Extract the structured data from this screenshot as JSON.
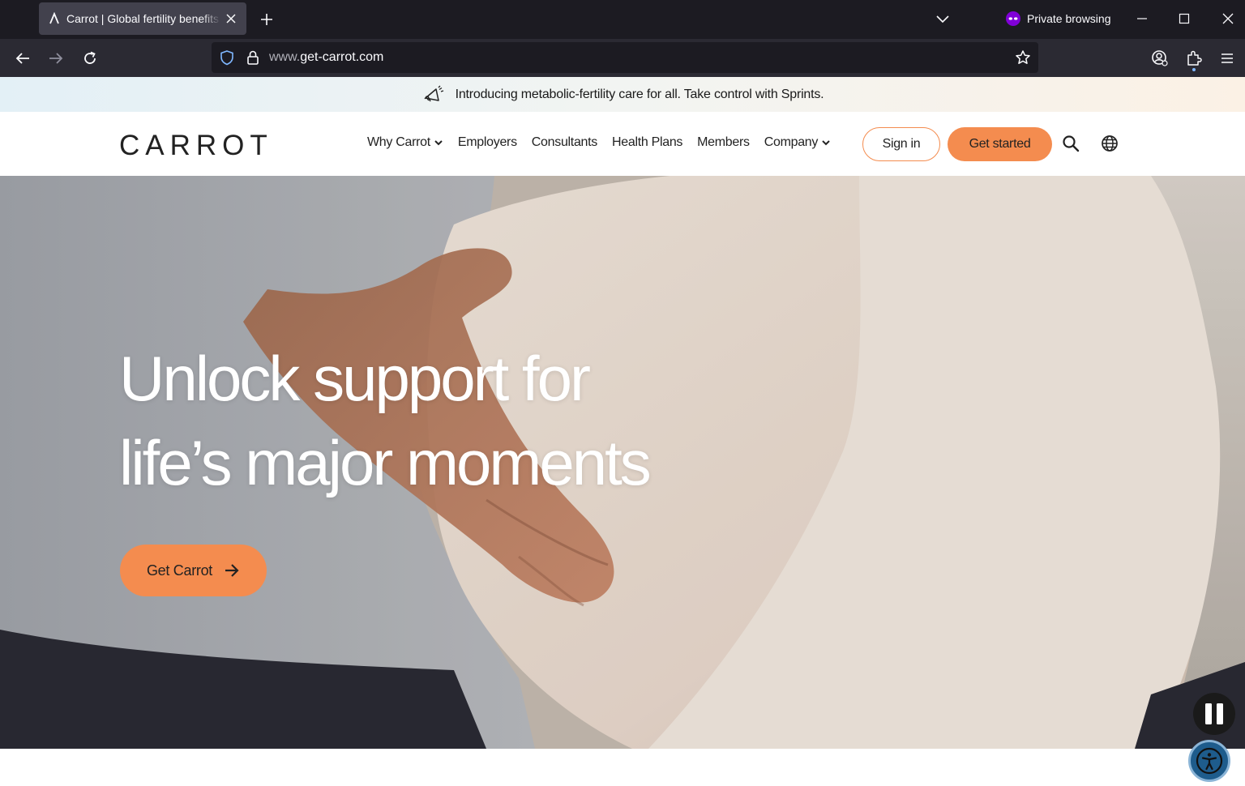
{
  "browser": {
    "tab": {
      "title": "Carrot | Global fertility benefits | Carrot",
      "favicon": "carrot-logo-icon"
    },
    "private_label": "Private browsing",
    "url": {
      "prefix": "www.",
      "domain": "get-carrot.com"
    }
  },
  "announcement": {
    "icon": "megaphone-icon",
    "text": "Introducing metabolic-fertility care for all. Take control with Sprints."
  },
  "header": {
    "logo": "CARROT",
    "nav": [
      {
        "label": "Why Carrot",
        "dropdown": true
      },
      {
        "label": "Employers",
        "dropdown": false
      },
      {
        "label": "Consultants",
        "dropdown": false
      },
      {
        "label": "Health Plans",
        "dropdown": false
      },
      {
        "label": "Members",
        "dropdown": false
      },
      {
        "label": "Company",
        "dropdown": true
      }
    ],
    "signin_label": "Sign in",
    "get_started_label": "Get started"
  },
  "hero": {
    "title_line1": "Unlock support for",
    "title_line2": "life’s major moments",
    "cta_label": "Get Carrot"
  },
  "colors": {
    "accent": "#f48c4f",
    "chrome_dark": "#1c1b22",
    "chrome_toolbar": "#2b2a33",
    "private_purple": "#8000d7"
  }
}
